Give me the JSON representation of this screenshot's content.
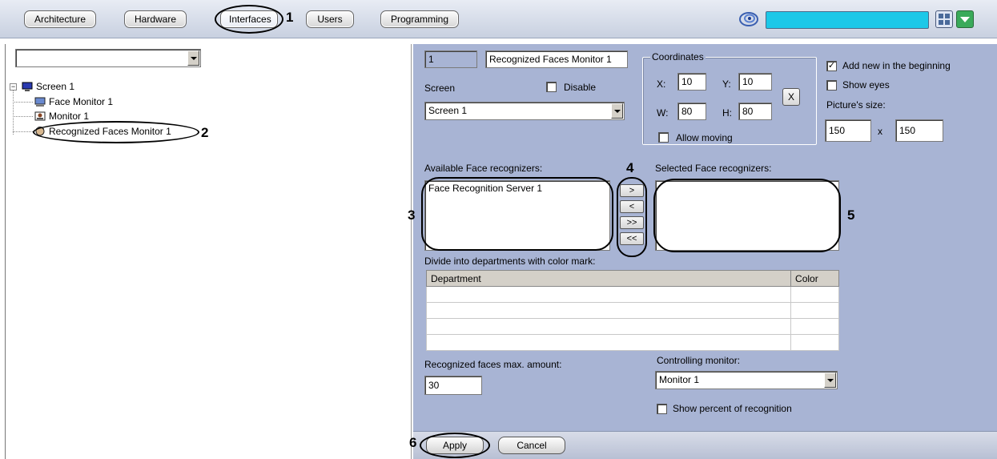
{
  "tabs": [
    {
      "label": "Architecture",
      "active": false
    },
    {
      "label": "Hardware",
      "active": false
    },
    {
      "label": "Interfaces",
      "active": true
    },
    {
      "label": "Users",
      "active": false
    },
    {
      "label": "Programming",
      "active": false
    }
  ],
  "top_icons": {
    "spiral": "spiral-logo-icon",
    "layout": "layout-grid-icon",
    "menu": "dropdown-arrow-icon"
  },
  "callouts": [
    "1",
    "2",
    "3",
    "4",
    "5",
    "6"
  ],
  "tree": {
    "filter_value": "",
    "root": {
      "label": "Screen 1",
      "icon": "screen-icon"
    },
    "children": [
      {
        "label": "Face Monitor 1",
        "icon": "monitor-icon"
      },
      {
        "label": "Monitor 1",
        "icon": "camera-monitor-icon"
      },
      {
        "label": "Recognized Faces Monitor 1",
        "icon": "face-icon",
        "selected": true
      }
    ]
  },
  "settings": {
    "id_value": "1",
    "name_value": "Recognized Faces Monitor 1",
    "screen_label": "Screen",
    "disable_label": "Disable",
    "disable_checked": false,
    "screen_value": "Screen 1",
    "coordinates": {
      "title": "Coordinates",
      "x_label": "X:",
      "x_value": "10",
      "y_label": "Y:",
      "y_value": "10",
      "w_label": "W:",
      "w_value": "80",
      "h_label": "H:",
      "h_value": "80",
      "reset_label": "X",
      "allow_moving_label": "Allow moving",
      "allow_moving_checked": false
    },
    "add_new_label": "Add new in the beginning",
    "add_new_checked": true,
    "show_eyes_label": "Show eyes",
    "show_eyes_checked": false,
    "picture_size_label": "Picture's size:",
    "picture_w": "150",
    "picture_x": "x",
    "picture_h": "150",
    "available_label": "Available Face recognizers:",
    "available_items": [
      "Face Recognition Server 1"
    ],
    "selected_label": "Selected Face recognizers:",
    "selected_items": [],
    "move_buttons": [
      ">",
      "<",
      ">>",
      "<<"
    ],
    "divide_label": "Divide into departments with color mark:",
    "dept_columns": [
      "Department",
      "Color"
    ],
    "max_amount_label": "Recognized faces max. amount:",
    "max_amount_value": "30",
    "controlling_label": "Controlling monitor:",
    "controlling_value": "Monitor 1",
    "show_percent_label": "Show percent of recognition",
    "show_percent_checked": false
  },
  "footer": {
    "apply_label": "Apply",
    "cancel_label": "Cancel"
  }
}
